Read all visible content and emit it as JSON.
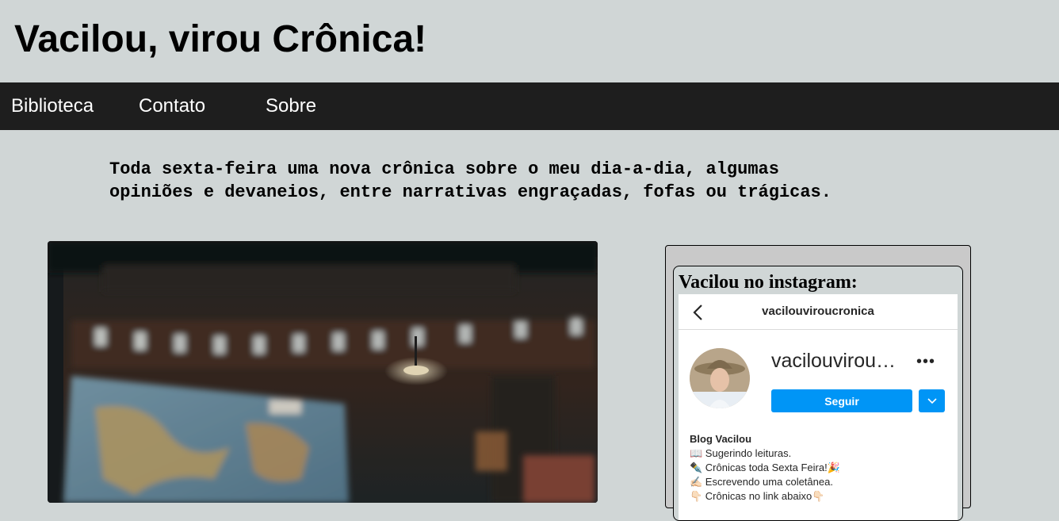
{
  "header": {
    "title": "Vacilou, virou Crônica!"
  },
  "nav": {
    "items": [
      "Biblioteca",
      "Contato",
      "Sobre"
    ]
  },
  "intro": {
    "line1": "Toda sexta-feira uma nova crônica sobre o meu dia-a-dia, algumas",
    "line2": "opiniões e devaneios, entre narrativas engraçadas, fofas ou trágicas."
  },
  "instagram": {
    "heading": "Vacilou no instagram:",
    "topbar_username": "vacilouviroucronica",
    "profile_name": "vacilouvirou…",
    "follow_label": "Seguir",
    "more_label": "•••",
    "bio_title": "Blog Vacilou",
    "bio_lines": [
      "📖 Sugerindo leituras.",
      "✒️ Crônicas toda Sexta Feira!🎉",
      "✍🏻 Escrevendo uma coletânea.",
      "👇🏻 Crônicas no link abaixo👇🏻"
    ]
  },
  "colors": {
    "page_bg": "#d0d6d6",
    "nav_bg": "#1e1e1e",
    "follow_blue": "#0095f6"
  },
  "icons": {
    "back": "chevron-left-icon",
    "more": "more-horizontal-icon",
    "dropdown": "chevron-down-icon"
  }
}
